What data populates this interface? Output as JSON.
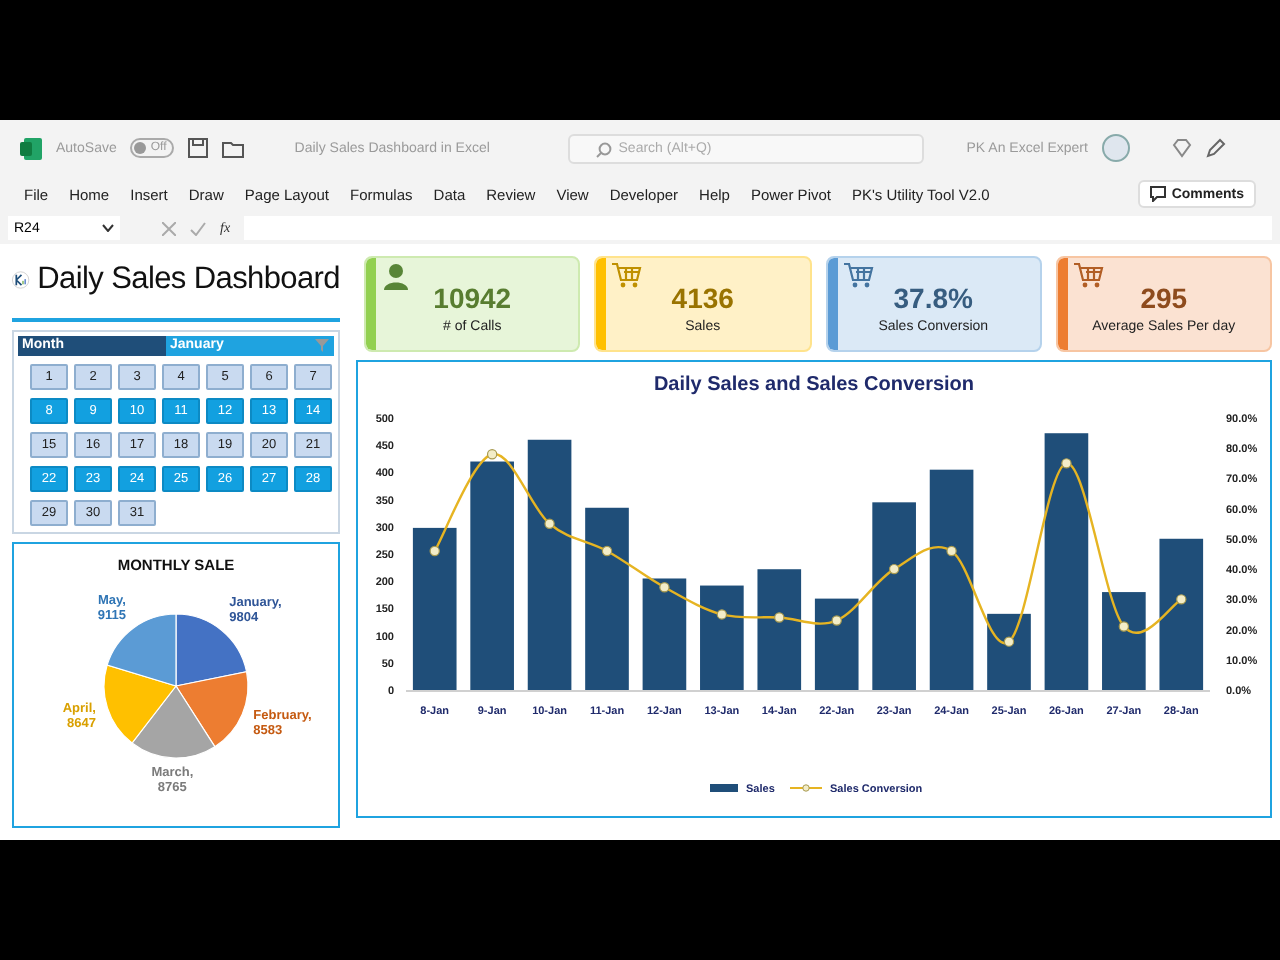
{
  "window": {
    "autosave_label": "AutoSave",
    "autosave": {
      "on": false,
      "label": "Off"
    },
    "title": "Daily Sales Dashboard in Excel",
    "search": {
      "placeholder": "Search (Alt+Q)"
    },
    "user": "PK An Excel Expert"
  },
  "menu": [
    "File",
    "Home",
    "Insert",
    "Draw",
    "Page Layout",
    "Formulas",
    "Data",
    "Review",
    "View",
    "Developer",
    "Help",
    "Power Pivot",
    "PK's Utility Tool V2.0"
  ],
  "comments_button": "Comments",
  "formula_bar": {
    "name_box": "R24",
    "fx": "fx"
  },
  "dashboard_title": "Daily Sales Dashboard",
  "slicer": {
    "field": "Month",
    "value": "January",
    "days": [
      {
        "label": "1",
        "selected": false
      },
      {
        "label": "2",
        "selected": false
      },
      {
        "label": "3",
        "selected": false
      },
      {
        "label": "4",
        "selected": false
      },
      {
        "label": "5",
        "selected": false
      },
      {
        "label": "6",
        "selected": false
      },
      {
        "label": "7",
        "selected": false
      },
      {
        "label": "8",
        "selected": true
      },
      {
        "label": "9",
        "selected": true
      },
      {
        "label": "10",
        "selected": true
      },
      {
        "label": "11",
        "selected": true
      },
      {
        "label": "12",
        "selected": true
      },
      {
        "label": "13",
        "selected": true
      },
      {
        "label": "14",
        "selected": true
      },
      {
        "label": "15",
        "selected": false
      },
      {
        "label": "16",
        "selected": false
      },
      {
        "label": "17",
        "selected": false
      },
      {
        "label": "18",
        "selected": false
      },
      {
        "label": "19",
        "selected": false
      },
      {
        "label": "20",
        "selected": false
      },
      {
        "label": "21",
        "selected": false
      },
      {
        "label": "22",
        "selected": true
      },
      {
        "label": "23",
        "selected": true
      },
      {
        "label": "24",
        "selected": true
      },
      {
        "label": "25",
        "selected": true
      },
      {
        "label": "26",
        "selected": true
      },
      {
        "label": "27",
        "selected": true
      },
      {
        "label": "28",
        "selected": true
      },
      {
        "label": "29",
        "selected": false
      },
      {
        "label": "30",
        "selected": false
      },
      {
        "label": "31",
        "selected": false
      }
    ]
  },
  "pie": {
    "label_separator": ",",
    "chart_data": {
      "type": "pie",
      "title": "MONTHLY SALE",
      "categories": [
        "January",
        "February",
        "March",
        "April",
        "May"
      ],
      "values": [
        9804,
        8583,
        8765,
        8647,
        9115
      ],
      "data_labels": true
    }
  },
  "kpis": [
    {
      "kind": "person",
      "value": "10942",
      "label": "# of Calls",
      "color": "#92d050"
    },
    {
      "kind": "cart",
      "value": "4136",
      "label": "Sales",
      "color": "#ffc000"
    },
    {
      "kind": "cart",
      "value": "37.8%",
      "label": "Sales Conversion",
      "color": "#5b9bd5"
    },
    {
      "kind": "cart",
      "value": "295",
      "label": "Average Sales Per day",
      "color": "#ed7d31"
    }
  ],
  "combo": {
    "chart_data": {
      "type": "bar",
      "title": "Daily Sales and Sales Conversion",
      "categories": [
        "8-Jan",
        "9-Jan",
        "10-Jan",
        "11-Jan",
        "12-Jan",
        "13-Jan",
        "14-Jan",
        "22-Jan",
        "23-Jan",
        "24-Jan",
        "25-Jan",
        "26-Jan",
        "27-Jan",
        "28-Jan"
      ],
      "series": [
        {
          "name": "Sales",
          "color": "#1f4e79",
          "values": [
            298,
            420,
            460,
            335,
            205,
            192,
            222,
            168,
            345,
            405,
            140,
            472,
            180,
            278
          ]
        },
        {
          "name": "Sales Conversion",
          "type": "line",
          "axis": "y2",
          "marker": "circle",
          "color": "#e6b422",
          "values": [
            0.46,
            0.78,
            0.55,
            0.46,
            0.34,
            0.25,
            0.24,
            0.23,
            0.4,
            0.46,
            0.16,
            0.75,
            0.21,
            0.3
          ]
        }
      ],
      "legend": "bottom",
      "ylim": [
        0,
        500
      ],
      "yticks": [
        0,
        50,
        100,
        150,
        200,
        250,
        300,
        350,
        400,
        450,
        500
      ],
      "y2lim": [
        0,
        0.9
      ],
      "y2ticks": [
        {
          "value": 0,
          "label": "0.0%"
        },
        {
          "value": 0.1,
          "label": "10.0%"
        },
        {
          "value": 0.2,
          "label": "20.0%"
        },
        {
          "value": 0.3,
          "label": "30.0%"
        },
        {
          "value": 0.4,
          "label": "40.0%"
        },
        {
          "value": 0.5,
          "label": "50.0%"
        },
        {
          "value": 0.6,
          "label": "60.0%"
        },
        {
          "value": 0.7,
          "label": "70.0%"
        },
        {
          "value": 0.8,
          "label": "80.0%"
        },
        {
          "value": 0.9,
          "label": "90.0%"
        }
      ]
    }
  }
}
